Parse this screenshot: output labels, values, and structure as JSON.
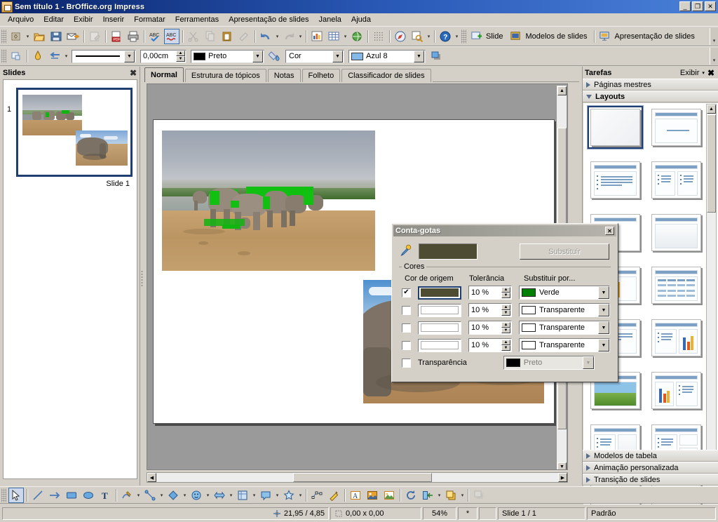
{
  "window": {
    "title": "Sem título 1 - BrOffice.org Impress",
    "icon": "impress-icon",
    "buttons": {
      "minimize": "_",
      "maximize": "❐",
      "close": "✕"
    }
  },
  "menubar": [
    {
      "label": "Arquivo",
      "name": "menu-arquivo"
    },
    {
      "label": "Editar",
      "name": "menu-editar"
    },
    {
      "label": "Exibir",
      "name": "menu-exibir"
    },
    {
      "label": "Inserir",
      "name": "menu-inserir"
    },
    {
      "label": "Formatar",
      "name": "menu-formatar"
    },
    {
      "label": "Ferramentas",
      "name": "menu-ferramentas"
    },
    {
      "label": "Apresentação de slides",
      "name": "menu-apresentacao-de-slides"
    },
    {
      "label": "Janela",
      "name": "menu-janela"
    },
    {
      "label": "Ajuda",
      "name": "menu-ajuda"
    }
  ],
  "toolbar_standard": {
    "presentation_buttons": [
      {
        "label": "Slide",
        "icon": "new-slide-icon"
      },
      {
        "label": "Modelos de slides",
        "icon": "slide-master-icon"
      },
      {
        "label": "Apresentação de slides",
        "icon": "start-slideshow-icon"
      }
    ],
    "overflow": "▾"
  },
  "toolbar_line": {
    "line_style_value": "",
    "line_width_value": "0,00cm",
    "line_color_value": "Preto",
    "fill_style_value": "Cor",
    "fill_color_value": "Azul 8"
  },
  "view_tabs": [
    {
      "label": "Normal",
      "active": true
    },
    {
      "label": "Estrutura de tópicos",
      "active": false
    },
    {
      "label": "Notas",
      "active": false
    },
    {
      "label": "Folheto",
      "active": false
    },
    {
      "label": "Classificador de slides",
      "active": false
    }
  ],
  "slides_panel": {
    "title": "Slides",
    "close": "✖",
    "slide_number": "1",
    "caption": "Slide 1"
  },
  "tasks_panel": {
    "title": "Tarefas",
    "view_label": "Exibir",
    "view_arrow": "▾",
    "close": "✖",
    "sections": [
      {
        "label": "Páginas mestres",
        "open": false
      },
      {
        "label": "Layouts",
        "open": true
      },
      {
        "label": "Modelos de tabela",
        "open": false
      },
      {
        "label": "Animação personalizada",
        "open": false
      },
      {
        "label": "Transição de slides",
        "open": false
      }
    ],
    "layouts": [
      {
        "name": "layout-blank",
        "kind": "blank",
        "selected": true
      },
      {
        "name": "layout-title-content",
        "kind": "title-center",
        "selected": false
      },
      {
        "name": "layout-title-bullets",
        "kind": "title-bullets",
        "selected": false
      },
      {
        "name": "layout-title-two-content",
        "kind": "title-two-bullets",
        "selected": false
      },
      {
        "name": "layout-title-only",
        "kind": "title-only-left",
        "selected": false
      },
      {
        "name": "layout-title-blank-box",
        "kind": "title-box",
        "selected": false
      },
      {
        "name": "layout-title-chart",
        "kind": "title-chart-left",
        "selected": false
      },
      {
        "name": "layout-title-table",
        "kind": "title-table",
        "selected": false
      },
      {
        "name": "layout-title-bullets-chart",
        "kind": "title-bullets-chart",
        "selected": false
      },
      {
        "name": "layout-title-image",
        "kind": "title-image",
        "selected": false
      },
      {
        "name": "layout-chart-bullets",
        "kind": "title-chart-bullets",
        "selected": false
      },
      {
        "name": "layout-bullets-box",
        "kind": "title-bullets-box",
        "selected": false
      },
      {
        "name": "layout-bullets-two-box",
        "kind": "title-bullets-two-box",
        "selected": false
      },
      {
        "name": "layout-extra-1",
        "kind": "title-only-left",
        "selected": false
      },
      {
        "name": "layout-extra-2",
        "kind": "title-only-left",
        "selected": false
      }
    ]
  },
  "dialog": {
    "title": "Conta-gotas",
    "close": "✕",
    "picker_icon": "eyedropper-icon",
    "picked_color": "#4e4d34",
    "replace_button": "Substituir",
    "group_legend": "Cores",
    "columns": {
      "source_color": "Cor de origem",
      "tolerance": "Tolerância",
      "replace_with": "Substituir por..."
    },
    "rows": [
      {
        "checked": true,
        "source_color": "#4e4d34",
        "tolerance": "10 %",
        "replace_label": "Verde",
        "replace_color": "#008000",
        "enabled": true
      },
      {
        "checked": false,
        "source_color": "#ffffff",
        "tolerance": "10 %",
        "replace_label": "Transparente",
        "replace_color": "#ffffff",
        "enabled": true
      },
      {
        "checked": false,
        "source_color": "#ffffff",
        "tolerance": "10 %",
        "replace_label": "Transparente",
        "replace_color": "#ffffff",
        "enabled": true
      },
      {
        "checked": false,
        "source_color": "#ffffff",
        "tolerance": "10 %",
        "replace_label": "Transparente",
        "replace_color": "#ffffff",
        "enabled": true
      }
    ],
    "transparency": {
      "checked": false,
      "label": "Transparência",
      "replace_label": "Preto",
      "replace_color": "#000000"
    }
  },
  "statusbar": {
    "position": "21,95 / 4,85",
    "size": "0,00 x 0,00",
    "zoom": "54%",
    "modified": "*",
    "slide_counter": "Slide 1 / 1",
    "style": "Padrão"
  },
  "colors": {
    "title_bar_start": "#0a246a",
    "face": "#d4d0c8",
    "canvas_bg": "#9a9a9a",
    "selection_blue": "#1f3f73",
    "green_replace": "#008000"
  }
}
